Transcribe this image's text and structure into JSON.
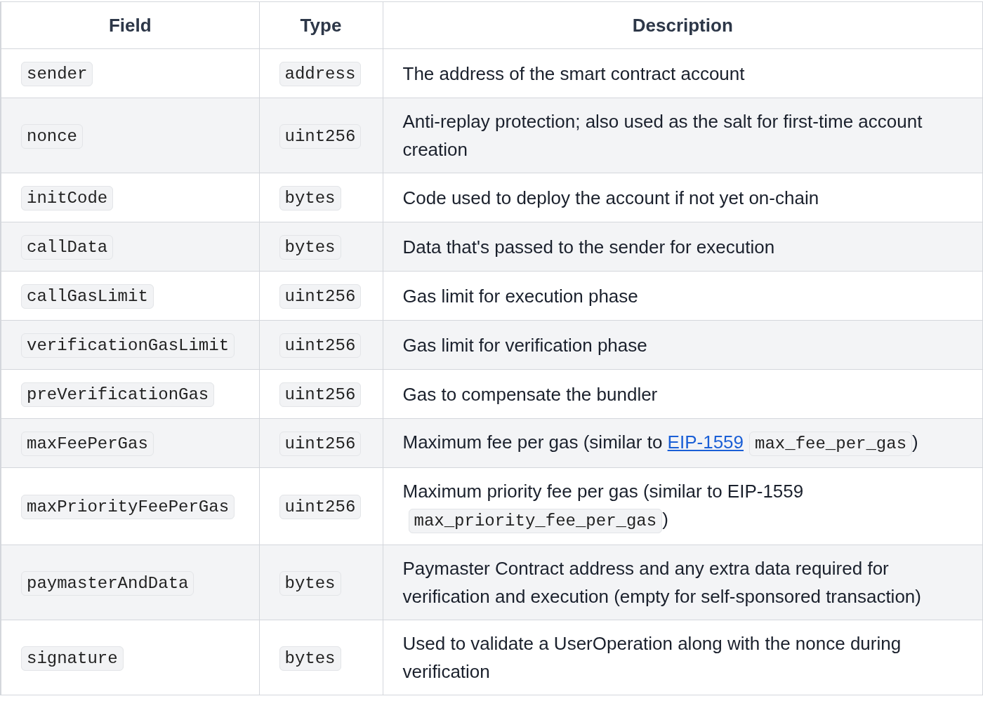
{
  "table": {
    "columns": [
      "Field",
      "Type",
      "Description"
    ],
    "rows": [
      {
        "field": "sender",
        "type": "address",
        "description": [
          {
            "kind": "text",
            "text": "The address of the smart contract account"
          }
        ]
      },
      {
        "field": "nonce",
        "type": "uint256",
        "description": [
          {
            "kind": "text",
            "text": "Anti-replay protection; also used as the salt for first-time account creation"
          }
        ]
      },
      {
        "field": "initCode",
        "type": "bytes",
        "description": [
          {
            "kind": "text",
            "text": "Code used to deploy the account if not yet on-chain"
          }
        ]
      },
      {
        "field": "callData",
        "type": "bytes",
        "description": [
          {
            "kind": "text",
            "text": "Data that's passed to the sender for execution"
          }
        ]
      },
      {
        "field": "callGasLimit",
        "type": "uint256",
        "description": [
          {
            "kind": "text",
            "text": "Gas limit for execution phase"
          }
        ]
      },
      {
        "field": "verificationGasLimit",
        "type": "uint256",
        "description": [
          {
            "kind": "text",
            "text": "Gas limit for verification phase"
          }
        ]
      },
      {
        "field": "preVerificationGas",
        "type": "uint256",
        "description": [
          {
            "kind": "text",
            "text": "Gas to compensate the bundler"
          }
        ]
      },
      {
        "field": "maxFeePerGas",
        "type": "uint256",
        "description": [
          {
            "kind": "text",
            "text": "Maximum fee per gas (similar to "
          },
          {
            "kind": "link",
            "text": "EIP-1559"
          },
          {
            "kind": "code",
            "text": "max_fee_per_gas"
          },
          {
            "kind": "text",
            "text": ")"
          }
        ]
      },
      {
        "field": "maxPriorityFeePerGas",
        "type": "uint256",
        "description": [
          {
            "kind": "text",
            "text": "Maximum priority fee per gas (similar to EIP-1559 "
          },
          {
            "kind": "code",
            "text": "max_priority_fee_per_gas"
          },
          {
            "kind": "text",
            "text": ")"
          }
        ]
      },
      {
        "field": "paymasterAndData",
        "type": "bytes",
        "description": [
          {
            "kind": "text",
            "text": "Paymaster Contract address and any extra data required for verification and execution (empty for self-sponsored transaction)"
          }
        ]
      },
      {
        "field": "signature",
        "type": "bytes",
        "description": [
          {
            "kind": "text",
            "text": "Used to validate a UserOperation along with the nonce during verification"
          }
        ]
      }
    ]
  }
}
